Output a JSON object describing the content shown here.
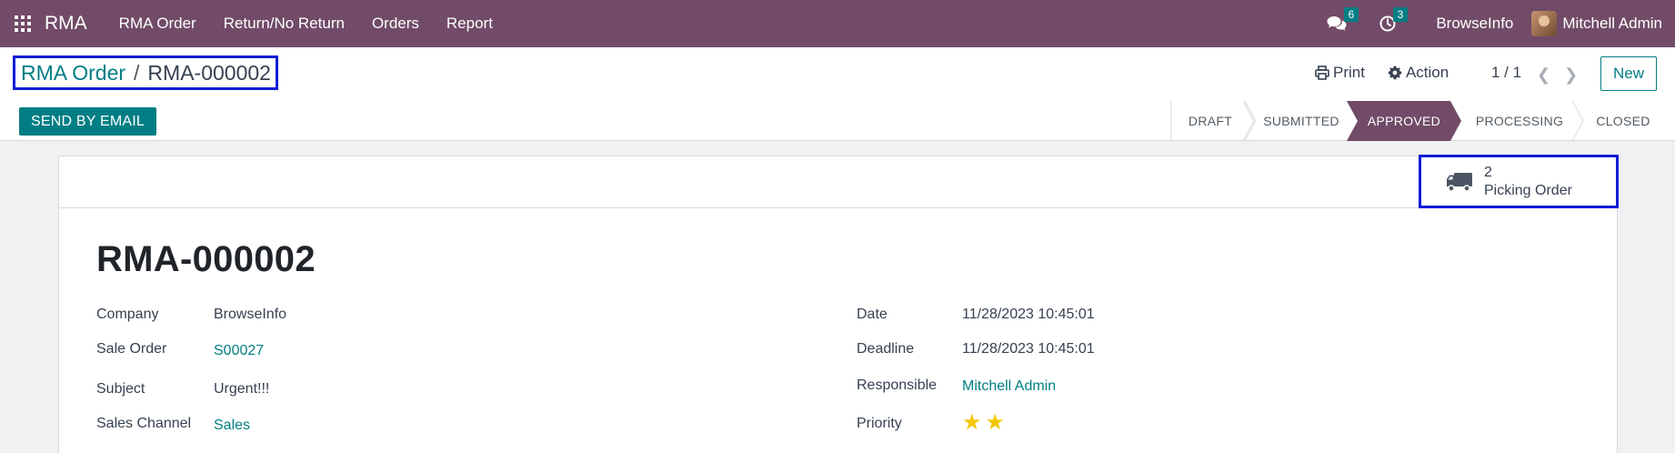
{
  "navbar": {
    "brand": "RMA",
    "menu": [
      "RMA Order",
      "Return/No Return",
      "Orders",
      "Report"
    ],
    "messages_count": "6",
    "activities_count": "3",
    "company": "BrowseInfo",
    "user": "Mitchell Admin"
  },
  "breadcrumb": {
    "parent": "RMA Order",
    "separator": "/",
    "current": "RMA-000002"
  },
  "toolbar": {
    "print_label": "Print",
    "action_label": "Action",
    "pager": "1 / 1",
    "new_label": "New",
    "send_email_label": "SEND BY EMAIL"
  },
  "statusbar": {
    "stages": [
      "DRAFT",
      "SUBMITTED",
      "APPROVED",
      "PROCESSING",
      "CLOSED"
    ],
    "active": "APPROVED"
  },
  "smart_button": {
    "count": "2",
    "label": "Picking Order"
  },
  "record": {
    "title": "RMA-000002",
    "left_fields": [
      {
        "label": "Company",
        "value": "BrowseInfo"
      },
      {
        "label": "Sale Order",
        "value": "S00027"
      },
      {
        "label": "Subject",
        "value": "Urgent!!!"
      },
      {
        "label": "Sales Channel",
        "value": "Sales"
      }
    ],
    "right_fields": [
      {
        "label": "Date",
        "value": "11/28/2023 10:45:01"
      },
      {
        "label": "Deadline",
        "value": "11/28/2023 10:45:01"
      },
      {
        "label": "Responsible",
        "value": "Mitchell Admin"
      },
      {
        "label": "Priority",
        "value": "2 of 2 stars"
      }
    ]
  },
  "colors": {
    "brand": "#714b67",
    "accent": "#017e84",
    "highlight_box": "#0f1ed6",
    "star": "#f3c700"
  }
}
